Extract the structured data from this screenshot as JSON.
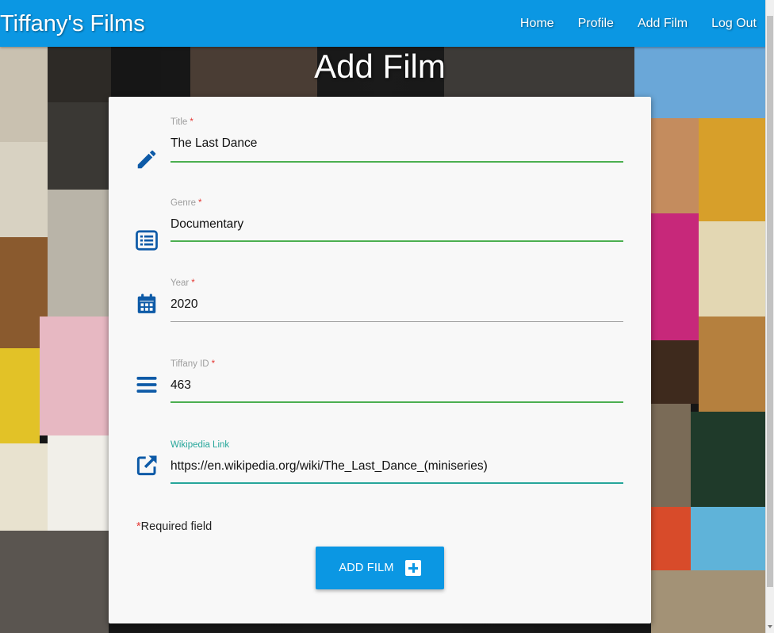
{
  "navbar": {
    "brand": "Tiffany's Films",
    "links": [
      "Home",
      "Profile",
      "Add Film",
      "Log Out"
    ]
  },
  "page": {
    "title": "Add Film"
  },
  "form": {
    "fields": [
      {
        "label": "Title",
        "required": "*",
        "value": "The Last Dance",
        "icon": "pencil-icon"
      },
      {
        "label": "Genre",
        "required": "*",
        "value": "Documentary",
        "icon": "list-icon"
      },
      {
        "label": "Year",
        "required": "*",
        "value": "2020",
        "icon": "calendar-icon"
      },
      {
        "label": "Tiffany ID",
        "required": "*",
        "value": "463",
        "icon": "menu-icon"
      },
      {
        "label": "Wikipedia Link",
        "required": "",
        "value": "https://en.wikipedia.org/wiki/The_Last_Dance_(miniseries)",
        "icon": "external-link-icon"
      }
    ],
    "required_note": {
      "star": "*",
      "text": "Required field"
    },
    "submit_label": "ADD FILM"
  },
  "colors": {
    "primary": "#0b97e3",
    "icon": "#0d5aa7",
    "valid": "#4caf50",
    "active": "#26a69a",
    "required": "#e53935"
  }
}
